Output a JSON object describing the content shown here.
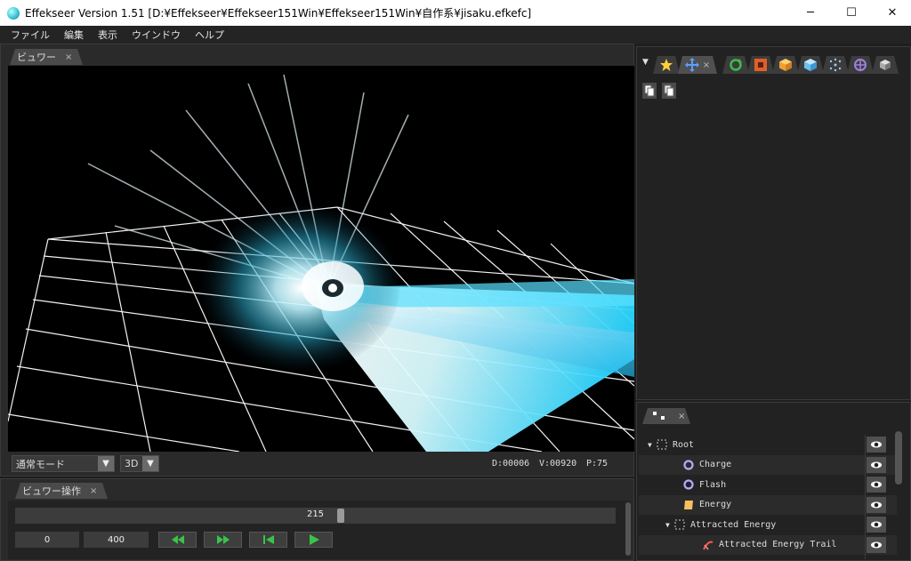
{
  "window": {
    "title": "Effekseer Version 1.51 [D:¥Effekseer¥Effekseer151Win¥Effekseer151Win¥自作系¥jisaku.efkefc]",
    "min_glyph": "─",
    "max_glyph": "☐",
    "close_glyph": "✕"
  },
  "menu": [
    "ファイル",
    "編集",
    "表示",
    "ウインドウ",
    "ヘルプ"
  ],
  "viewer": {
    "tab_label": "ビュワー",
    "tab_close": "×",
    "mode": "通常モード",
    "dimension": "3D",
    "dropdown_arrow": "▼",
    "stats": {
      "d": "D:00006",
      "v": "V:00920",
      "p": "P:75"
    }
  },
  "control": {
    "tab_label": "ビュワー操作",
    "tab_close": "×",
    "frame_value": "215",
    "frame_progress": 0.537,
    "start_frame": "0",
    "end_frame": "400",
    "buttons": [
      "rewind",
      "fast-forward",
      "step-back",
      "play"
    ]
  },
  "tools": {
    "menu_glyph": "▼",
    "tab_close": "×",
    "tabs": [
      "star-icon",
      "move-icon",
      "rotate-icon",
      "scale-icon",
      "box-icon",
      "cube-icon",
      "particles-icon",
      "target-icon",
      "block-icon"
    ]
  },
  "nodes": {
    "tab_close": "×",
    "items": [
      {
        "label": "Root",
        "arrow": "▼",
        "icon": "dashed-box-icon",
        "alt": false
      },
      {
        "label": "Charge",
        "arrow": "",
        "icon": "ring-icon",
        "alt": true
      },
      {
        "label": "Flash",
        "arrow": "",
        "icon": "ring-icon",
        "alt": false
      },
      {
        "label": "Energy",
        "arrow": "",
        "icon": "sprite-icon",
        "alt": true
      },
      {
        "label": "Attracted Energy",
        "arrow": "▼",
        "icon": "dashed-box-icon",
        "alt": false
      },
      {
        "label": "Attracted Energy Trail",
        "arrow": "",
        "icon": "trail-icon",
        "alt": true
      }
    ]
  },
  "colors": {
    "accent": "#4cc8e8",
    "play_green": "#39c447",
    "ring_purple": "#b8a8ff",
    "sprite_yellow": "#f4c060"
  }
}
